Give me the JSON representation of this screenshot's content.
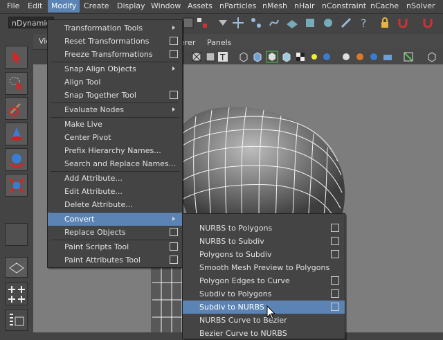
{
  "menubar": {
    "items": [
      "File",
      "Edit",
      "Modify",
      "Create",
      "Display",
      "Window",
      "Assets",
      "nParticles",
      "nMesh",
      "nHair",
      "nConstraint",
      "nCache",
      "nSolver"
    ]
  },
  "status_line": {
    "mode_value": "nDynamics"
  },
  "viewport": {
    "menu_visible": [
      "Vie",
      "erer",
      "Panels"
    ]
  },
  "modify_menu": {
    "items": [
      {
        "label": "Transformation Tools"
      },
      {
        "label": "Reset Transformations"
      },
      {
        "label": "Freeze Transformations"
      },
      {
        "label": "Snap Align Objects"
      },
      {
        "label": "Align Tool"
      },
      {
        "label": "Snap Together Tool"
      },
      {
        "label": "Evaluate Nodes"
      },
      {
        "label": "Make Live"
      },
      {
        "label": "Center Pivot"
      },
      {
        "label": "Prefix Hierarchy Names..."
      },
      {
        "label": "Search and Replace Names..."
      },
      {
        "label": "Add Attribute..."
      },
      {
        "label": "Edit Attribute..."
      },
      {
        "label": "Delete Attribute..."
      },
      {
        "label": "Convert"
      },
      {
        "label": "Replace Objects"
      },
      {
        "label": "Paint Scripts Tool"
      },
      {
        "label": "Paint Attributes Tool"
      }
    ]
  },
  "convert_submenu": {
    "items": [
      {
        "label": "NURBS to Polygons"
      },
      {
        "label": "NURBS to Subdiv"
      },
      {
        "label": "Polygons to Subdiv"
      },
      {
        "label": "Smooth Mesh Preview to Polygons"
      },
      {
        "label": "Polygon Edges to Curve"
      },
      {
        "label": "Subdiv to Polygons"
      },
      {
        "label": "Subdiv to NURBS"
      },
      {
        "label": "NURBS Curve to Bezier"
      },
      {
        "label": "Bezier Curve to NURBS"
      }
    ]
  },
  "icons": [
    "select-tool-icon",
    "lasso-select-icon",
    "paint-select-icon",
    "move-tool-icon",
    "rotate-tool-icon",
    "scale-tool-icon",
    "magnet-icon",
    "lock-icon",
    "help-icon",
    "sphere-icon",
    "cube-icon",
    "cursor-arrow-icon"
  ],
  "colors": {
    "highlight": "#5b84b4",
    "menu_bg": "#444444",
    "viewport_bg": "#7d7d7d"
  }
}
